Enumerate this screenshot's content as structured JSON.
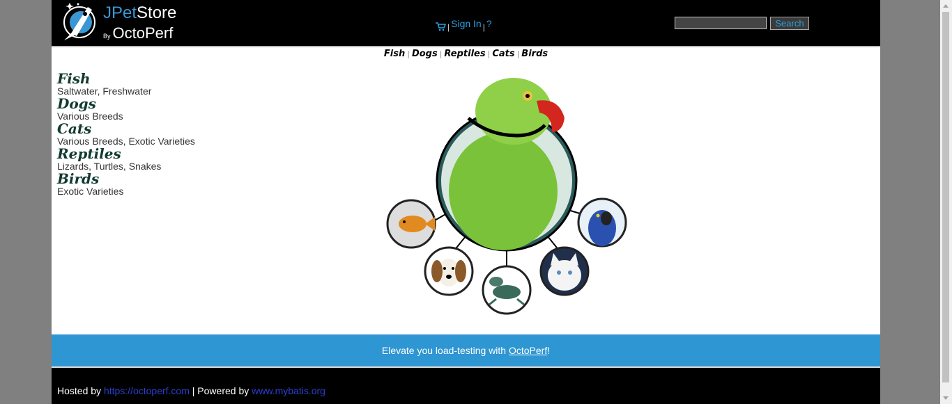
{
  "header": {
    "logo_title_j": "JPet",
    "logo_title_rest": "Store",
    "logo_by": "By",
    "logo_brand": "OctoPerf",
    "menu": {
      "cart_icon": "shopping-cart-icon",
      "sign_in": "Sign In",
      "help": "?"
    },
    "search": {
      "placeholder": "",
      "button_label": "Search"
    }
  },
  "quicklinks": [
    "Fish",
    "Dogs",
    "Reptiles",
    "Cats",
    "Birds"
  ],
  "sidebar": {
    "categories": [
      {
        "name": "Fish",
        "description": "Saltwater, Freshwater"
      },
      {
        "name": "Dogs",
        "description": "Various Breeds"
      },
      {
        "name": "Cats",
        "description": "Various Breeds, Exotic Varieties"
      },
      {
        "name": "Reptiles",
        "description": "Lizards, Turtles, Snakes"
      },
      {
        "name": "Birds",
        "description": "Exotic Varieties"
      }
    ]
  },
  "promo": {
    "prefix": "Elevate you load-testing with ",
    "link": "OctoPerf",
    "suffix": "!"
  },
  "footer": {
    "hosted_by": "Hosted by ",
    "hosted_link": "https://octoperf.com",
    "powered_by": " | Powered by ",
    "powered_link": "www.mybatis.org"
  },
  "colors": {
    "header_bg": "#000000",
    "accent_blue": "#2e96d2",
    "link_blue": "#2aa0e0"
  }
}
